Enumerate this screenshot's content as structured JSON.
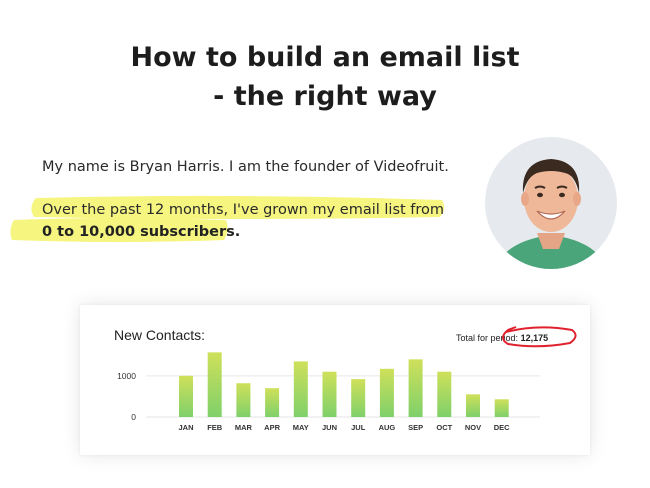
{
  "heading": {
    "line1": "How to build an email list",
    "line2": "- the right way"
  },
  "intro_text": "My name is Bryan Harris. I am the founder of Videofruit.",
  "highlight": {
    "line1": "Over the past 12 months, I've grown my email list from",
    "line2": "0 to 10,000 subscribers."
  },
  "colors": {
    "highlight": "#f3f36a",
    "bar_top": "#cfe05a",
    "bar_bottom": "#7fd06a",
    "circle": "#e0222e"
  },
  "card": {
    "title": "New Contacts:",
    "total_label": "Total for period:",
    "total_value": "12,175"
  },
  "chart_data": {
    "type": "bar",
    "categories": [
      "JAN",
      "FEB",
      "MAR",
      "APR",
      "MAY",
      "JUN",
      "JUL",
      "AUG",
      "SEP",
      "OCT",
      "NOV",
      "DEC"
    ],
    "values": [
      1000,
      1570,
      820,
      700,
      1350,
      1100,
      920,
      1170,
      1400,
      1100,
      550,
      430
    ],
    "yticks": [
      0,
      1000
    ],
    "ylim": [
      0,
      1700
    ],
    "grid": true
  }
}
